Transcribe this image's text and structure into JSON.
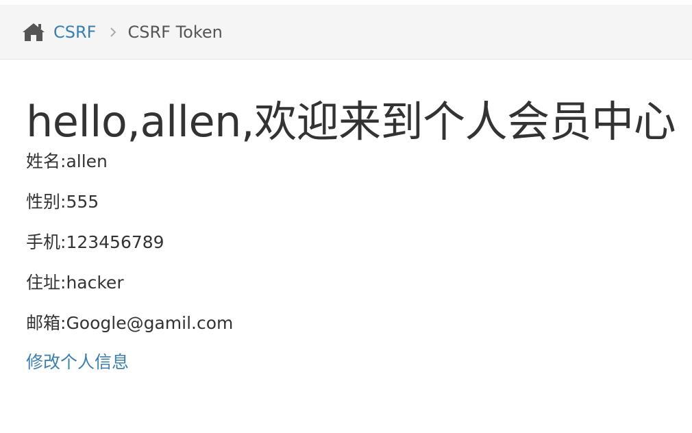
{
  "breadcrumb": {
    "home_icon": "home-icon",
    "link_label": "CSRF",
    "separator_icon": "chevron-right-icon",
    "current_label": "CSRF Token"
  },
  "main": {
    "title": "hello,allen,欢迎来到个人会员中心",
    "fields": [
      {
        "label": "姓名:",
        "value": "allen"
      },
      {
        "label": "性别:",
        "value": "555"
      },
      {
        "label": "手机:",
        "value": "123456789"
      },
      {
        "label": "住址:",
        "value": "hacker"
      },
      {
        "label": "邮箱:",
        "value": "Google@gamil.com"
      }
    ],
    "edit_link": "修改个人信息"
  },
  "colors": {
    "link": "#3a7fb1",
    "breadcrumb_bg": "#f5f5f5",
    "text": "#333333"
  }
}
